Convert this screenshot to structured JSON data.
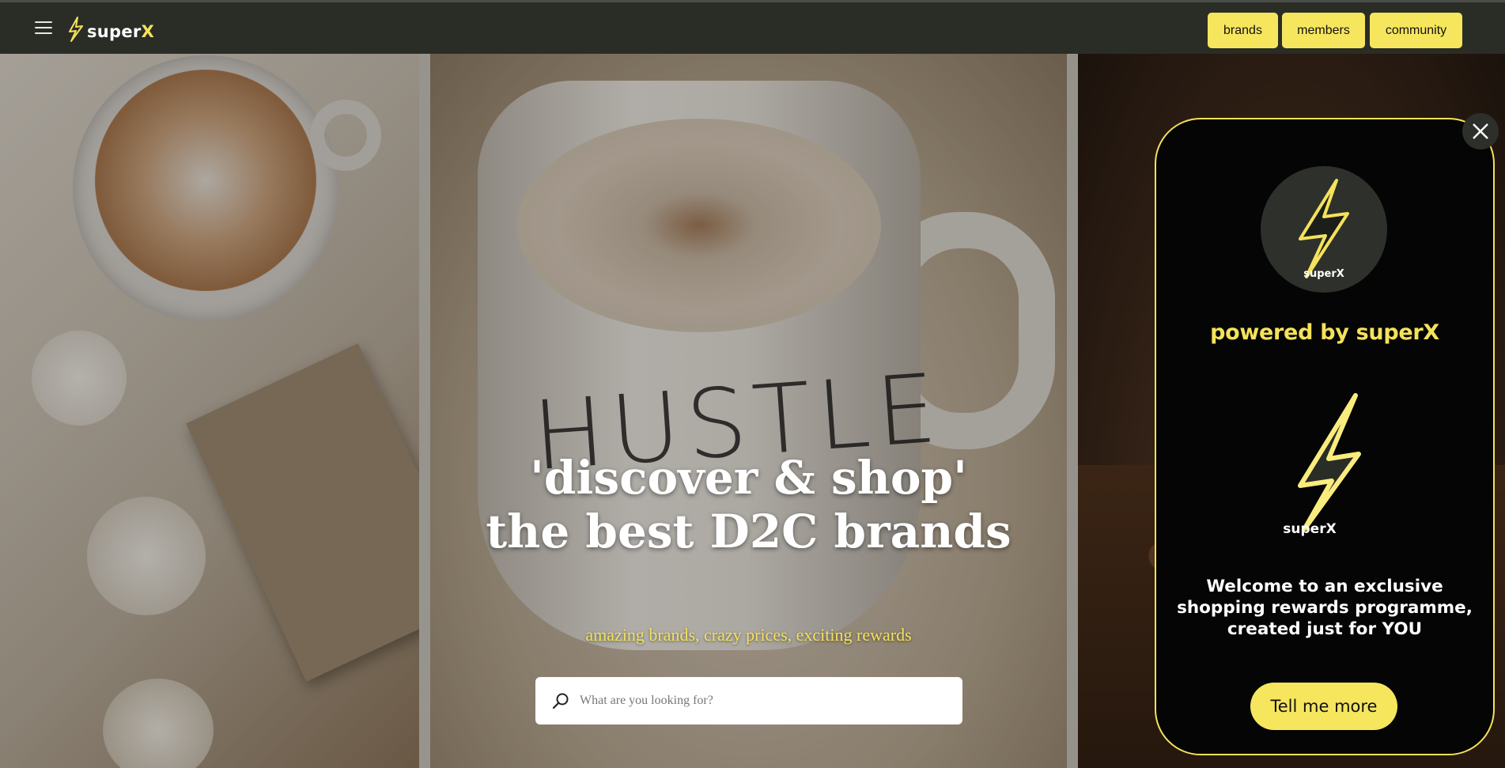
{
  "header": {
    "menu_icon": "hamburger-menu-icon",
    "logo": {
      "text_main": "super",
      "text_accent": "X",
      "icon": "lightning-bolt-icon"
    },
    "nav": [
      {
        "label": "brands"
      },
      {
        "label": "members"
      },
      {
        "label": "community"
      }
    ]
  },
  "hero": {
    "title_line1": "'discover & shop'",
    "title_line2": "the best D2C brands",
    "subtitle": "amazing brands, crazy prices, exciting rewards",
    "search": {
      "placeholder": "What are you looking for?",
      "value": "",
      "icon": "search-icon"
    },
    "mug_print": "HUSTLE"
  },
  "popup": {
    "close_icon": "close-icon",
    "badge_logo_text": "superX",
    "powered_by": "powered by superX",
    "big_logo_text": "superX",
    "welcome": "Welcome to an exclusive shopping rewards programme, created just for YOU",
    "cta_label": "Tell me more"
  },
  "colors": {
    "accent_yellow": "#f6e65e",
    "topbar_bg": "#2a2d26",
    "popup_bg": "#050505",
    "popup_border": "#f4e25a"
  }
}
